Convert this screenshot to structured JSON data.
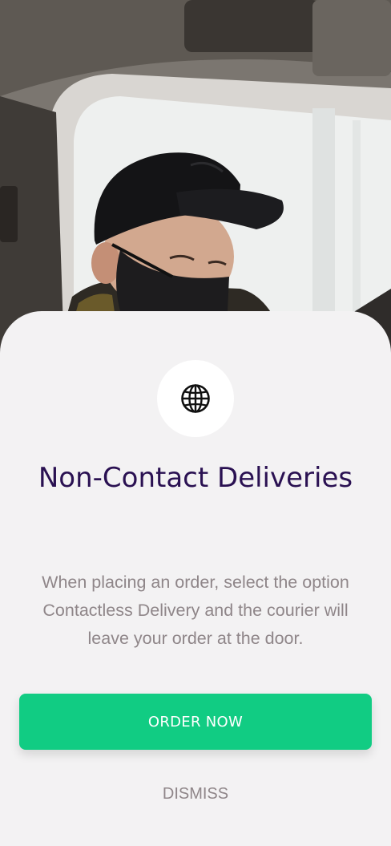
{
  "hero": {
    "photo_subject": "courier-wearing-cap-and-face-mask-in-van"
  },
  "card": {
    "icon": "globe-icon",
    "title": "Non-Contact Deliveries",
    "description": "When placing an order, select the option Contactless Delivery and the courier will leave your order at the door.",
    "primary_button_label": "ORDER NOW",
    "secondary_button_label": "DISMISS"
  },
  "colors": {
    "accent": "#11cc83",
    "title": "#2a1152",
    "body_text": "#8f8689",
    "background": "#f3f2f3"
  }
}
